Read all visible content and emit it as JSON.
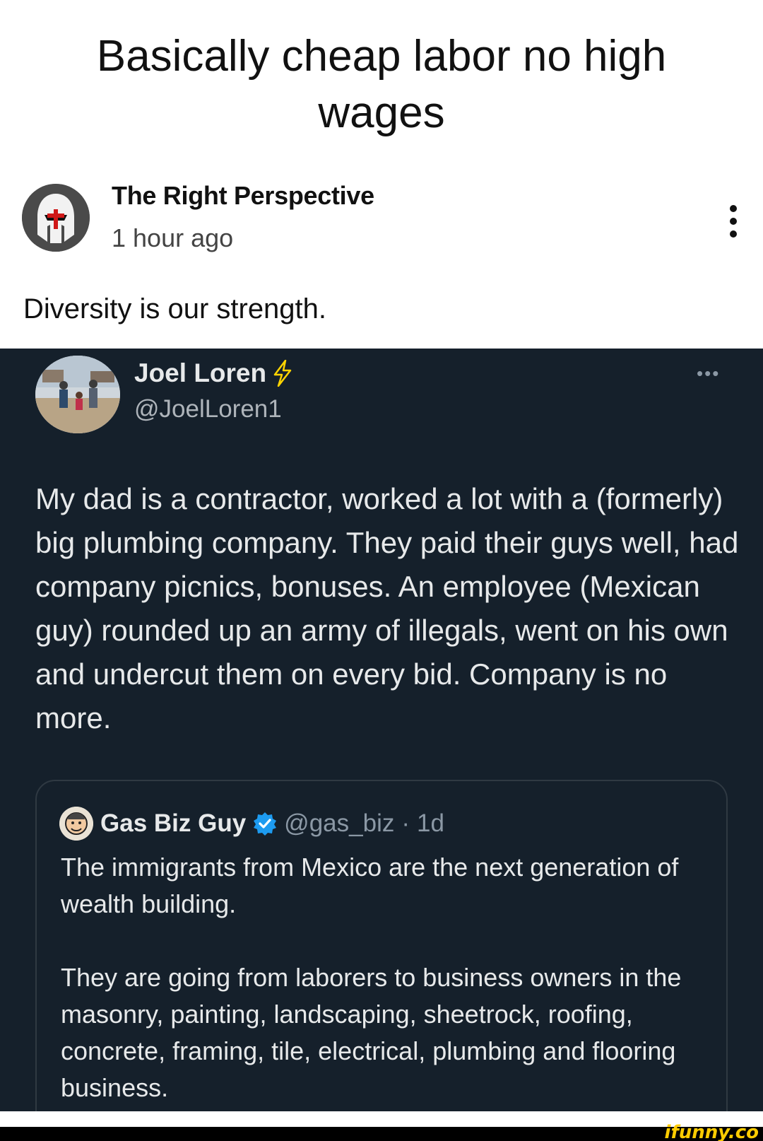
{
  "caption": "Basically cheap labor no high wages",
  "post": {
    "author": "The Right Perspective",
    "time": "1 hour ago",
    "text": "Diversity is our strength."
  },
  "tweet": {
    "name": "Joel Loren",
    "handle": "@JoelLoren1",
    "more_icon": "more-horizontal-icon",
    "body": "My dad is a contractor, worked a lot with a (formerly) big plumbing company. They paid their guys well, had company picnics, bonuses. An employee (Mexican guy) rounded up an army of illegals, went on his own and undercut them on every bid. Company is no more.",
    "quoted": {
      "name": "Gas Biz Guy",
      "handle": "@gas_biz",
      "separator": "·",
      "age": "1d",
      "paragraph1": "The immigrants from Mexico are the next generation of wealth building.",
      "paragraph2": "They are going from laborers to business owners in the masonry, painting, landscaping, sheetrock, roofing, concrete, framing, tile, electrical, plumbing and flooring business."
    }
  },
  "watermark": "ifunny.co",
  "colors": {
    "tweet_bg": "#15202b",
    "verified": "#1d9bf0",
    "lightning": "#ffd400",
    "watermark": "#ffcc00"
  }
}
